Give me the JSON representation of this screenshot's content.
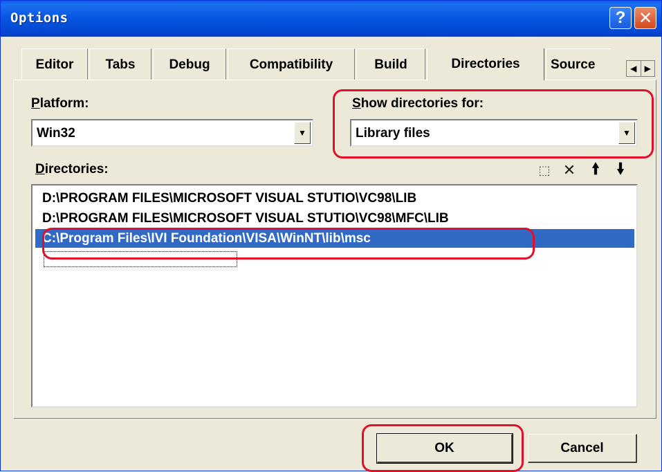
{
  "window": {
    "title": "Options"
  },
  "titlebar_buttons": {
    "help": "?",
    "close": "✕"
  },
  "tabs": [
    {
      "label": "Editor",
      "active": false
    },
    {
      "label": "Tabs",
      "active": false
    },
    {
      "label": "Debug",
      "active": false
    },
    {
      "label": "Compatibility",
      "active": false
    },
    {
      "label": "Build",
      "active": false
    },
    {
      "label": "Directories",
      "active": true
    },
    {
      "label": "Source",
      "active": false
    }
  ],
  "tab_scroll": {
    "left": "◀",
    "right": "▶"
  },
  "platform": {
    "label_prefix": "P",
    "label_rest": "latform:",
    "value": "Win32"
  },
  "show_for": {
    "label_prefix": "S",
    "label_rest": "how directories for:",
    "value": "Library files"
  },
  "directories": {
    "label_prefix": "D",
    "label_rest": "irectories:",
    "items": [
      {
        "text": "D:\\PROGRAM FILES\\MICROSOFT VISUAL STUTIO\\VC98\\LIB",
        "selected": false
      },
      {
        "text": "D:\\PROGRAM FILES\\MICROSOFT VISUAL STUTIO\\VC98\\MFC\\LIB",
        "selected": false
      },
      {
        "text": "C:\\Program Files\\IVI Foundation\\VISA\\WinNT\\lib\\msc",
        "selected": true
      }
    ]
  },
  "icons": {
    "new_folder": "new-folder-icon",
    "delete": "delete-icon",
    "move_up": "arrow-up-icon",
    "move_down": "arrow-down-icon"
  },
  "buttons": {
    "ok": "OK",
    "cancel": "Cancel"
  },
  "colors": {
    "title_blue": "#0655e0",
    "selection": "#316ac5",
    "highlight_red": "#e0102a"
  }
}
